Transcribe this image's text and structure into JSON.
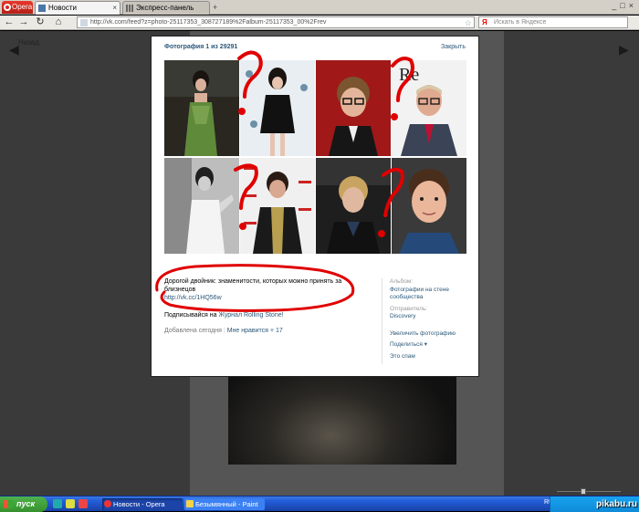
{
  "browser": {
    "menu_label": "Opera",
    "tabs": [
      {
        "label": "Новости",
        "active": true
      },
      {
        "label": "Экспресс-панель",
        "active": false
      }
    ],
    "address": "http://vk.com/feed?z=photo-25117353_308727189%2Falbum-25117353_00%2Frev",
    "search_placeholder": "Искать в Яндексе",
    "search_engine_letter": "Я"
  },
  "page": {
    "prev_label": "Назад"
  },
  "viewer": {
    "counter": "Фотография 1 из 29291",
    "close_label": "Закрыть",
    "caption": {
      "line1": "Дорогой двойник: знаменитости, которых можно принять за близнецов",
      "link": "http://vk.cc/1HQ56w",
      "source_prefix": "Подписывайся на ",
      "source_link": "Журнал Rolling Stone!",
      "added": "Добавлена сегодня",
      "like_label": "Мне нравится",
      "like_count": "17"
    },
    "sidebar": {
      "album_label": "Альбом:",
      "album_value": "Фотографии на стене сообщества",
      "sender_label": "Отправитель:",
      "sender_value": "Discovery",
      "actions": [
        "Увеличить фотографию",
        "Поделиться ▾",
        "Это спам"
      ]
    }
  },
  "taskbar": {
    "start_label": "пуск",
    "tasks": [
      {
        "label": "Новости - Opera",
        "active": true
      },
      {
        "label": "Безымянный - Paint",
        "active": false
      }
    ],
    "lang": "RU",
    "watermark": "pikabu.ru"
  },
  "colors": {
    "vk_link": "#2b587a",
    "scribble": "#e00000",
    "xp_taskbar": "#245edb",
    "xp_start": "#36912d"
  }
}
